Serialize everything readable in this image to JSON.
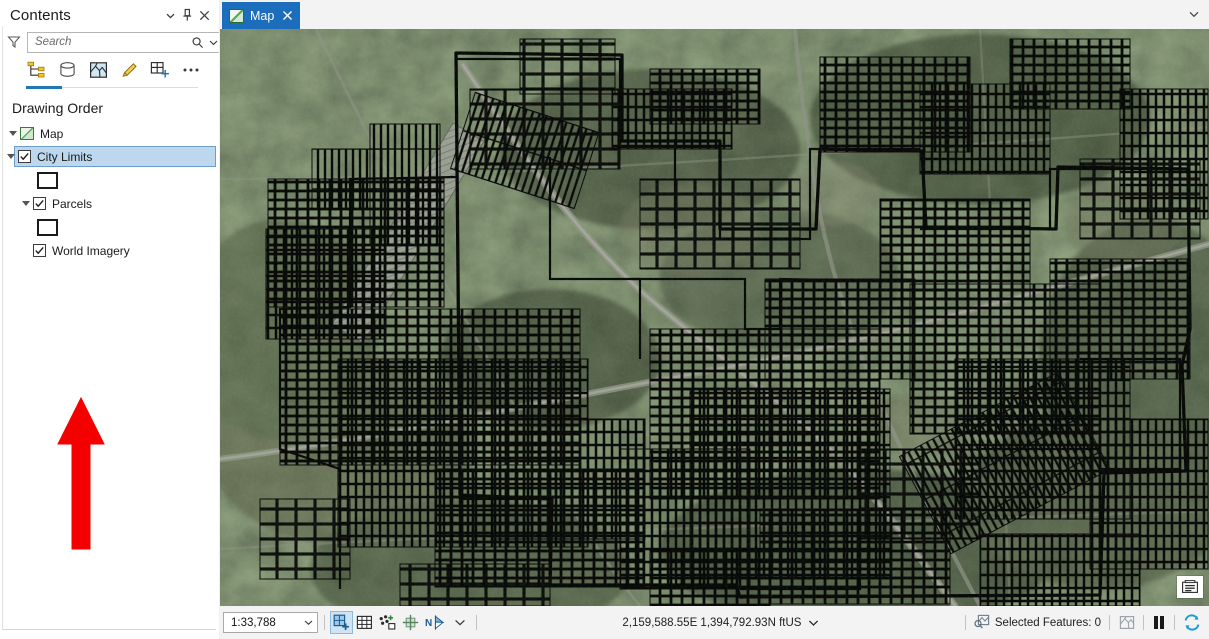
{
  "pane": {
    "title": "Contents",
    "header_buttons": [
      {
        "name": "pane-menu-chevron",
        "label": "ˇ"
      },
      {
        "name": "pane-pin",
        "label": "pin"
      },
      {
        "name": "pane-close",
        "label": "×"
      }
    ],
    "search": {
      "placeholder": "Search",
      "filter_icon": "filter-icon",
      "search_icon": "search-icon",
      "dropdown_icon": "chevron-down-icon"
    },
    "toolbar": [
      {
        "name": "list-by-drawing-order-icon",
        "tooltip": "List By Drawing Order",
        "active": true
      },
      {
        "name": "list-by-data-source-icon",
        "tooltip": "List By Data Source",
        "active": false
      },
      {
        "name": "list-by-selection-icon",
        "tooltip": "List By Selection",
        "active": false
      },
      {
        "name": "list-by-editing-icon",
        "tooltip": "List By Editing",
        "active": false
      },
      {
        "name": "list-by-snapping-icon",
        "tooltip": "List By Snapping",
        "active": false
      },
      {
        "name": "more-options-icon",
        "tooltip": "More",
        "active": false
      }
    ],
    "section_label": "Drawing Order",
    "tree": {
      "map_node": {
        "label": "Map",
        "icon": "map-node-icon",
        "expanded": true
      },
      "layers": [
        {
          "label": "City Limits",
          "checked": true,
          "expanded": true,
          "selected": true,
          "symbol": "hollow-square-outline"
        },
        {
          "label": "Parcels",
          "checked": true,
          "expanded": true,
          "selected": false,
          "symbol": "hollow-square-outline"
        },
        {
          "label": "World Imagery",
          "checked": true,
          "expanded": false,
          "selected": false,
          "symbol": null
        }
      ]
    },
    "annotation": {
      "type": "red-arrow-up",
      "color": "#f50000",
      "points_at": "World Imagery"
    }
  },
  "mapview": {
    "tabs": [
      {
        "label": "Map",
        "active": true,
        "icon": "map-tab-icon",
        "close_icon": "close-icon"
      }
    ],
    "tabstrip_overflow_icon": "chevron-down-icon",
    "active_tab_color": "#1c6ebc",
    "legend_button_name": "map-overlay-legend-button"
  },
  "statusbar": {
    "scale": {
      "value": "1:33,788",
      "caret": "caret-down-icon"
    },
    "nav_tools": [
      {
        "name": "selection-tool-icon",
        "active": true
      },
      {
        "name": "grid-tool-icon",
        "active": false
      },
      {
        "name": "add-data-tool-icon",
        "active": false
      },
      {
        "name": "zoom-full-extent-icon",
        "active": false
      },
      {
        "name": "north-arrow-navigator-icon",
        "active": false
      },
      {
        "name": "nav-overflow-caret-icon",
        "active": false
      }
    ],
    "coordinates": "2,159,588.55E 1,394,792.93N ftUS",
    "coordinates_caret": "caret-down-icon",
    "selected_features_label": "Selected Features: 0",
    "selected_features_icon": "selection-magnifier-icon",
    "extent_icon": "map-extent-icon",
    "pause_icon": "pause-drawing-icon",
    "refresh_icon": "refresh-icon"
  },
  "colors": {
    "tab_blue": "#1c6ebc",
    "selection_blue": "#bdd7ee",
    "accent_blue": "#1f78b4",
    "annotation_red": "#f50000",
    "panel_bg": "#ffffff",
    "chrome_bg": "#f3f3f3"
  }
}
